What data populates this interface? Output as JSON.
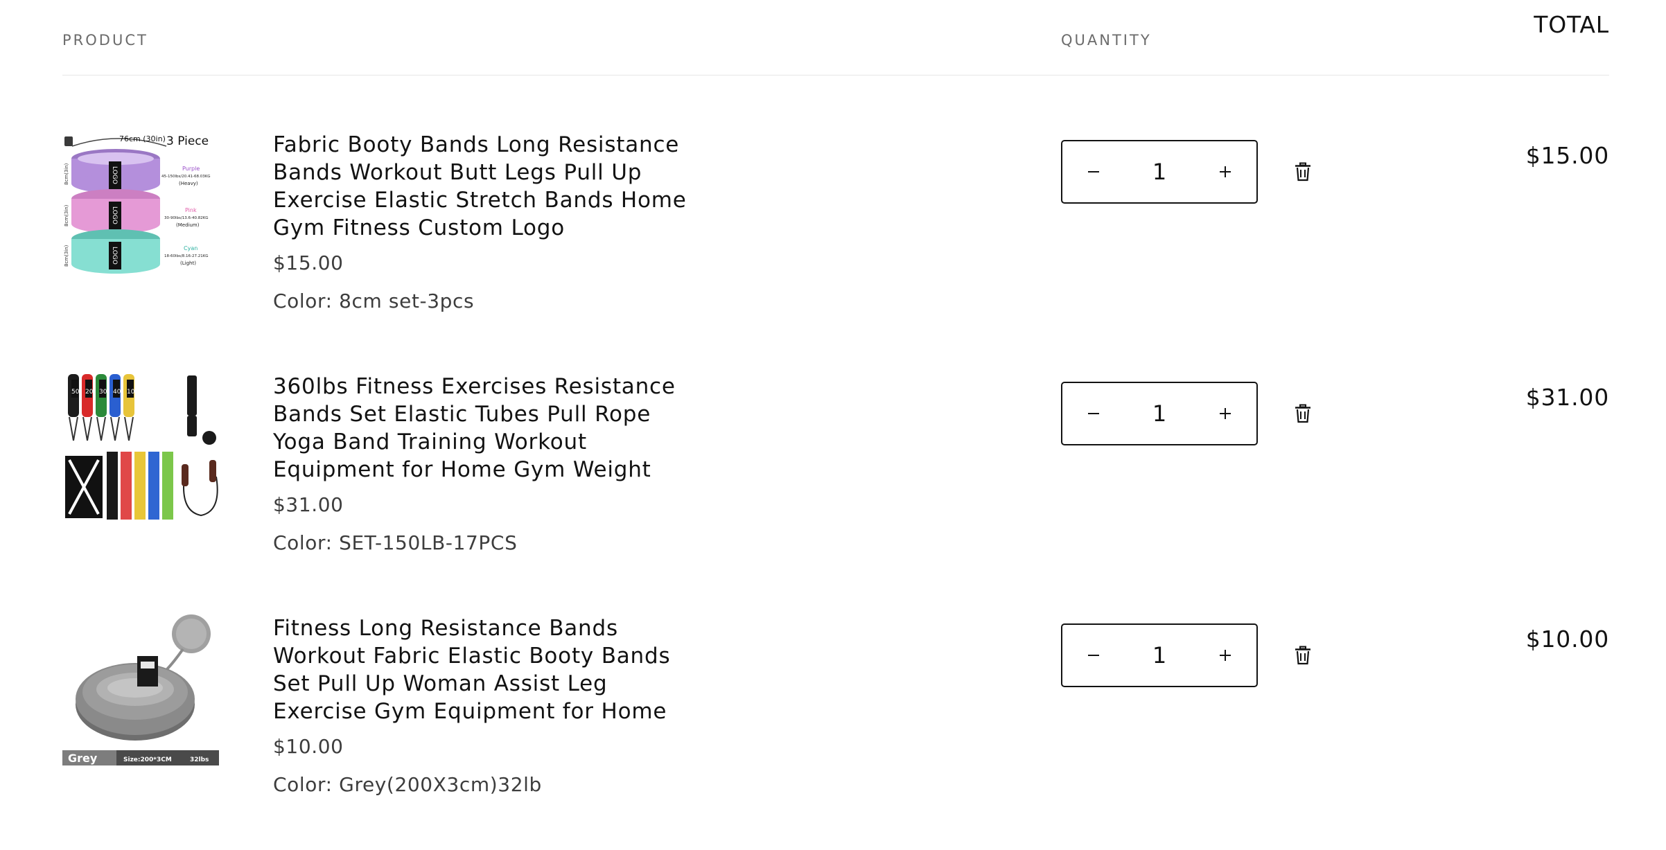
{
  "headers": {
    "product": "PRODUCT",
    "quantity": "QUANTITY",
    "total": "TOTAL"
  },
  "items": [
    {
      "title": "Fabric Booty Bands Long Resistance Bands Workout Butt Legs Pull Up Exercise Elastic Stretch Bands Home Gym Fitness Custom Logo",
      "price": "$15.00",
      "variant": "Color: 8cm set-3pcs",
      "quantity": "1",
      "total": "$15.00",
      "image_text": {
        "top": "76cm (30in)",
        "count": "3 Piece",
        "band": "LOGO",
        "height": "8cm(3in)",
        "purple": "Purple",
        "purple_range": "45-150lbs/20.41-68.03KG",
        "purple_level": "(Heavy)",
        "pink": "Pink",
        "pink_range": "30-90lbs/13.6-40.82KG",
        "pink_level": "(Medium)",
        "cyan": "Cyan",
        "cyan_range": "18-60lbs/8.16-27.21KG",
        "cyan_level": "(Light)"
      }
    },
    {
      "title": "360lbs Fitness Exercises Resistance Bands Set Elastic Tubes Pull Rope Yoga Band Training Workout Equipment for Home Gym Weight",
      "price": "$31.00",
      "variant": "Color: SET-150LB-17PCS",
      "quantity": "1",
      "total": "$31.00",
      "image_text": {
        "tube_labels": [
          "50",
          "20",
          "30",
          "40",
          "10"
        ]
      }
    },
    {
      "title": "Fitness Long Resistance Bands Workout Fabric Elastic Booty Bands Set Pull Up Woman Assist Leg Exercise Gym Equipment for Home",
      "price": "$10.00",
      "variant": "Color: Grey(200X3cm)32lb",
      "quantity": "1",
      "total": "$10.00",
      "image_text": {
        "color": "Grey",
        "size": "Size:200*3CM",
        "weight": "32lbs"
      }
    }
  ],
  "icons": {
    "minus": "minus-icon",
    "plus": "plus-icon",
    "remove": "trash-icon"
  },
  "colors": {
    "text": "#121212",
    "muted": "#3d3d3d",
    "header": "#6b6b6b",
    "divider": "#e6e6e6"
  }
}
